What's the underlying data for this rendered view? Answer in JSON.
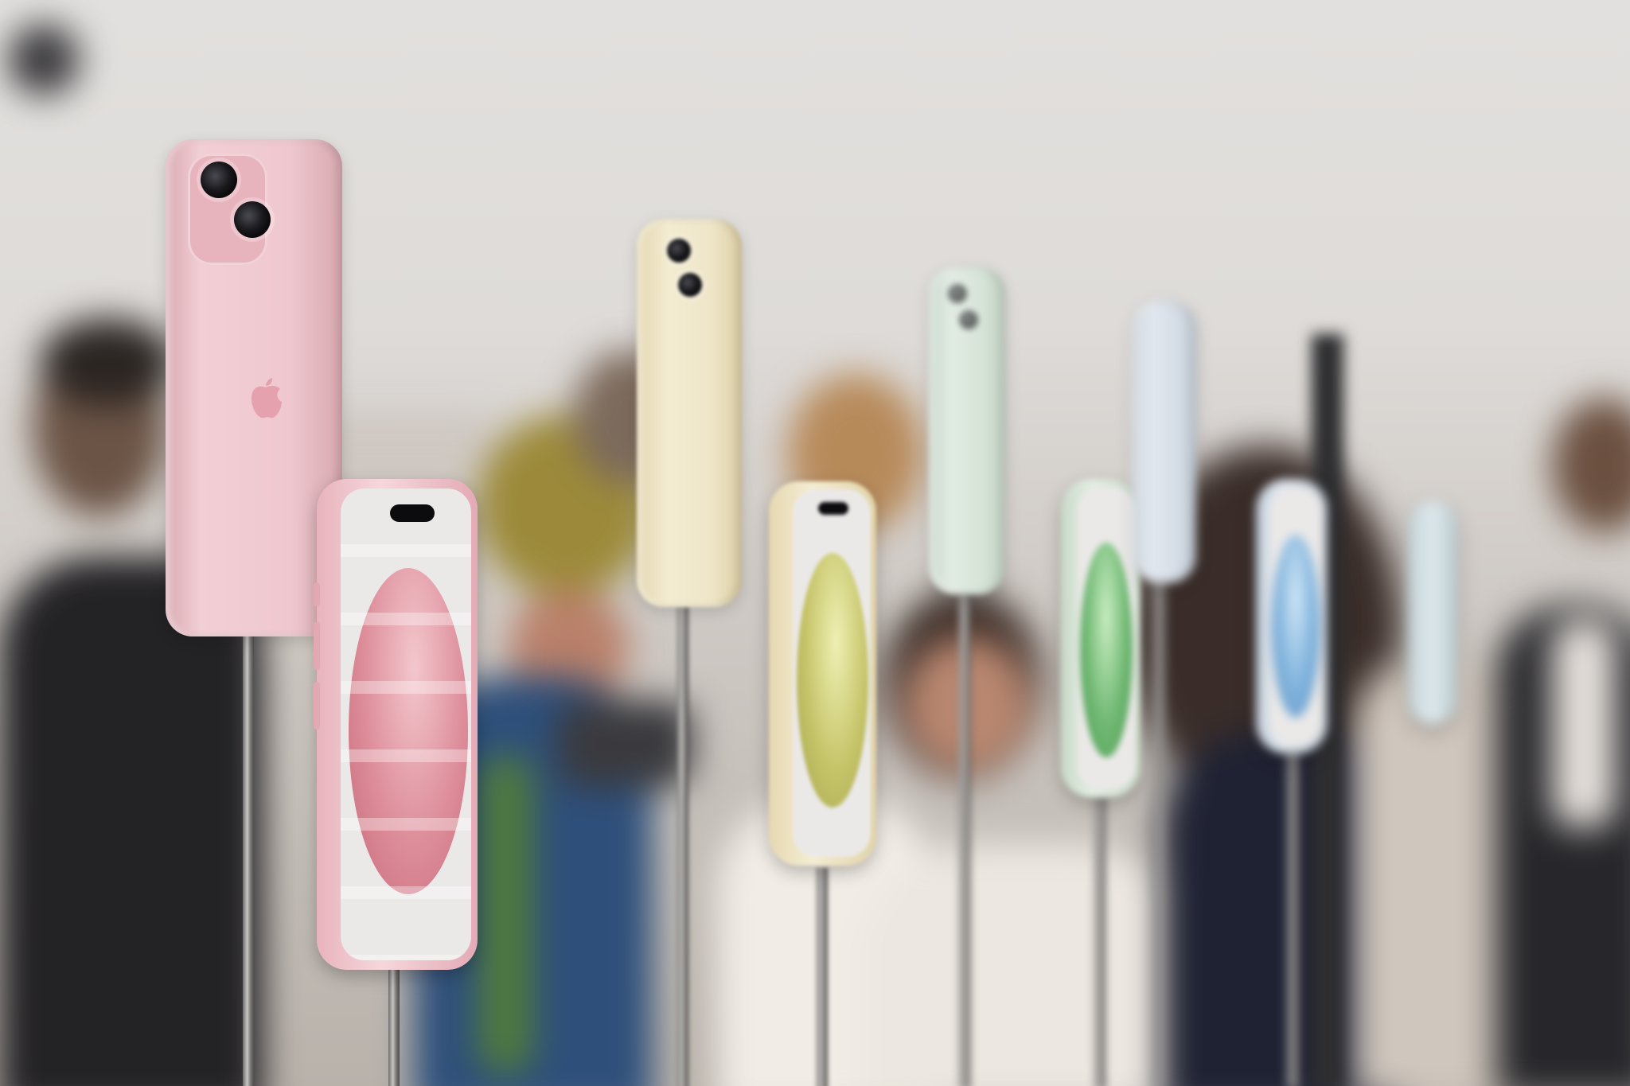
{
  "scene": {
    "description_tags": [
      "phone-display",
      "product-launch"
    ],
    "colors": {
      "background": "#dedbd8",
      "pink": "#efc8cf",
      "yellow": "#efe6c9",
      "green": "#d6e3d7",
      "blue": "#d5dde6",
      "black": "#2c2c2e"
    }
  },
  "phones": [
    {
      "color_name": "pink",
      "side": "back"
    },
    {
      "color_name": "pink",
      "side": "front"
    },
    {
      "color_name": "yellow",
      "side": "back"
    },
    {
      "color_name": "yellow",
      "side": "front"
    },
    {
      "color_name": "green",
      "side": "back"
    },
    {
      "color_name": "green",
      "side": "front"
    },
    {
      "color_name": "blue",
      "side": "back"
    },
    {
      "color_name": "blue",
      "side": "front"
    },
    {
      "color_name": "black",
      "side": "back"
    }
  ]
}
